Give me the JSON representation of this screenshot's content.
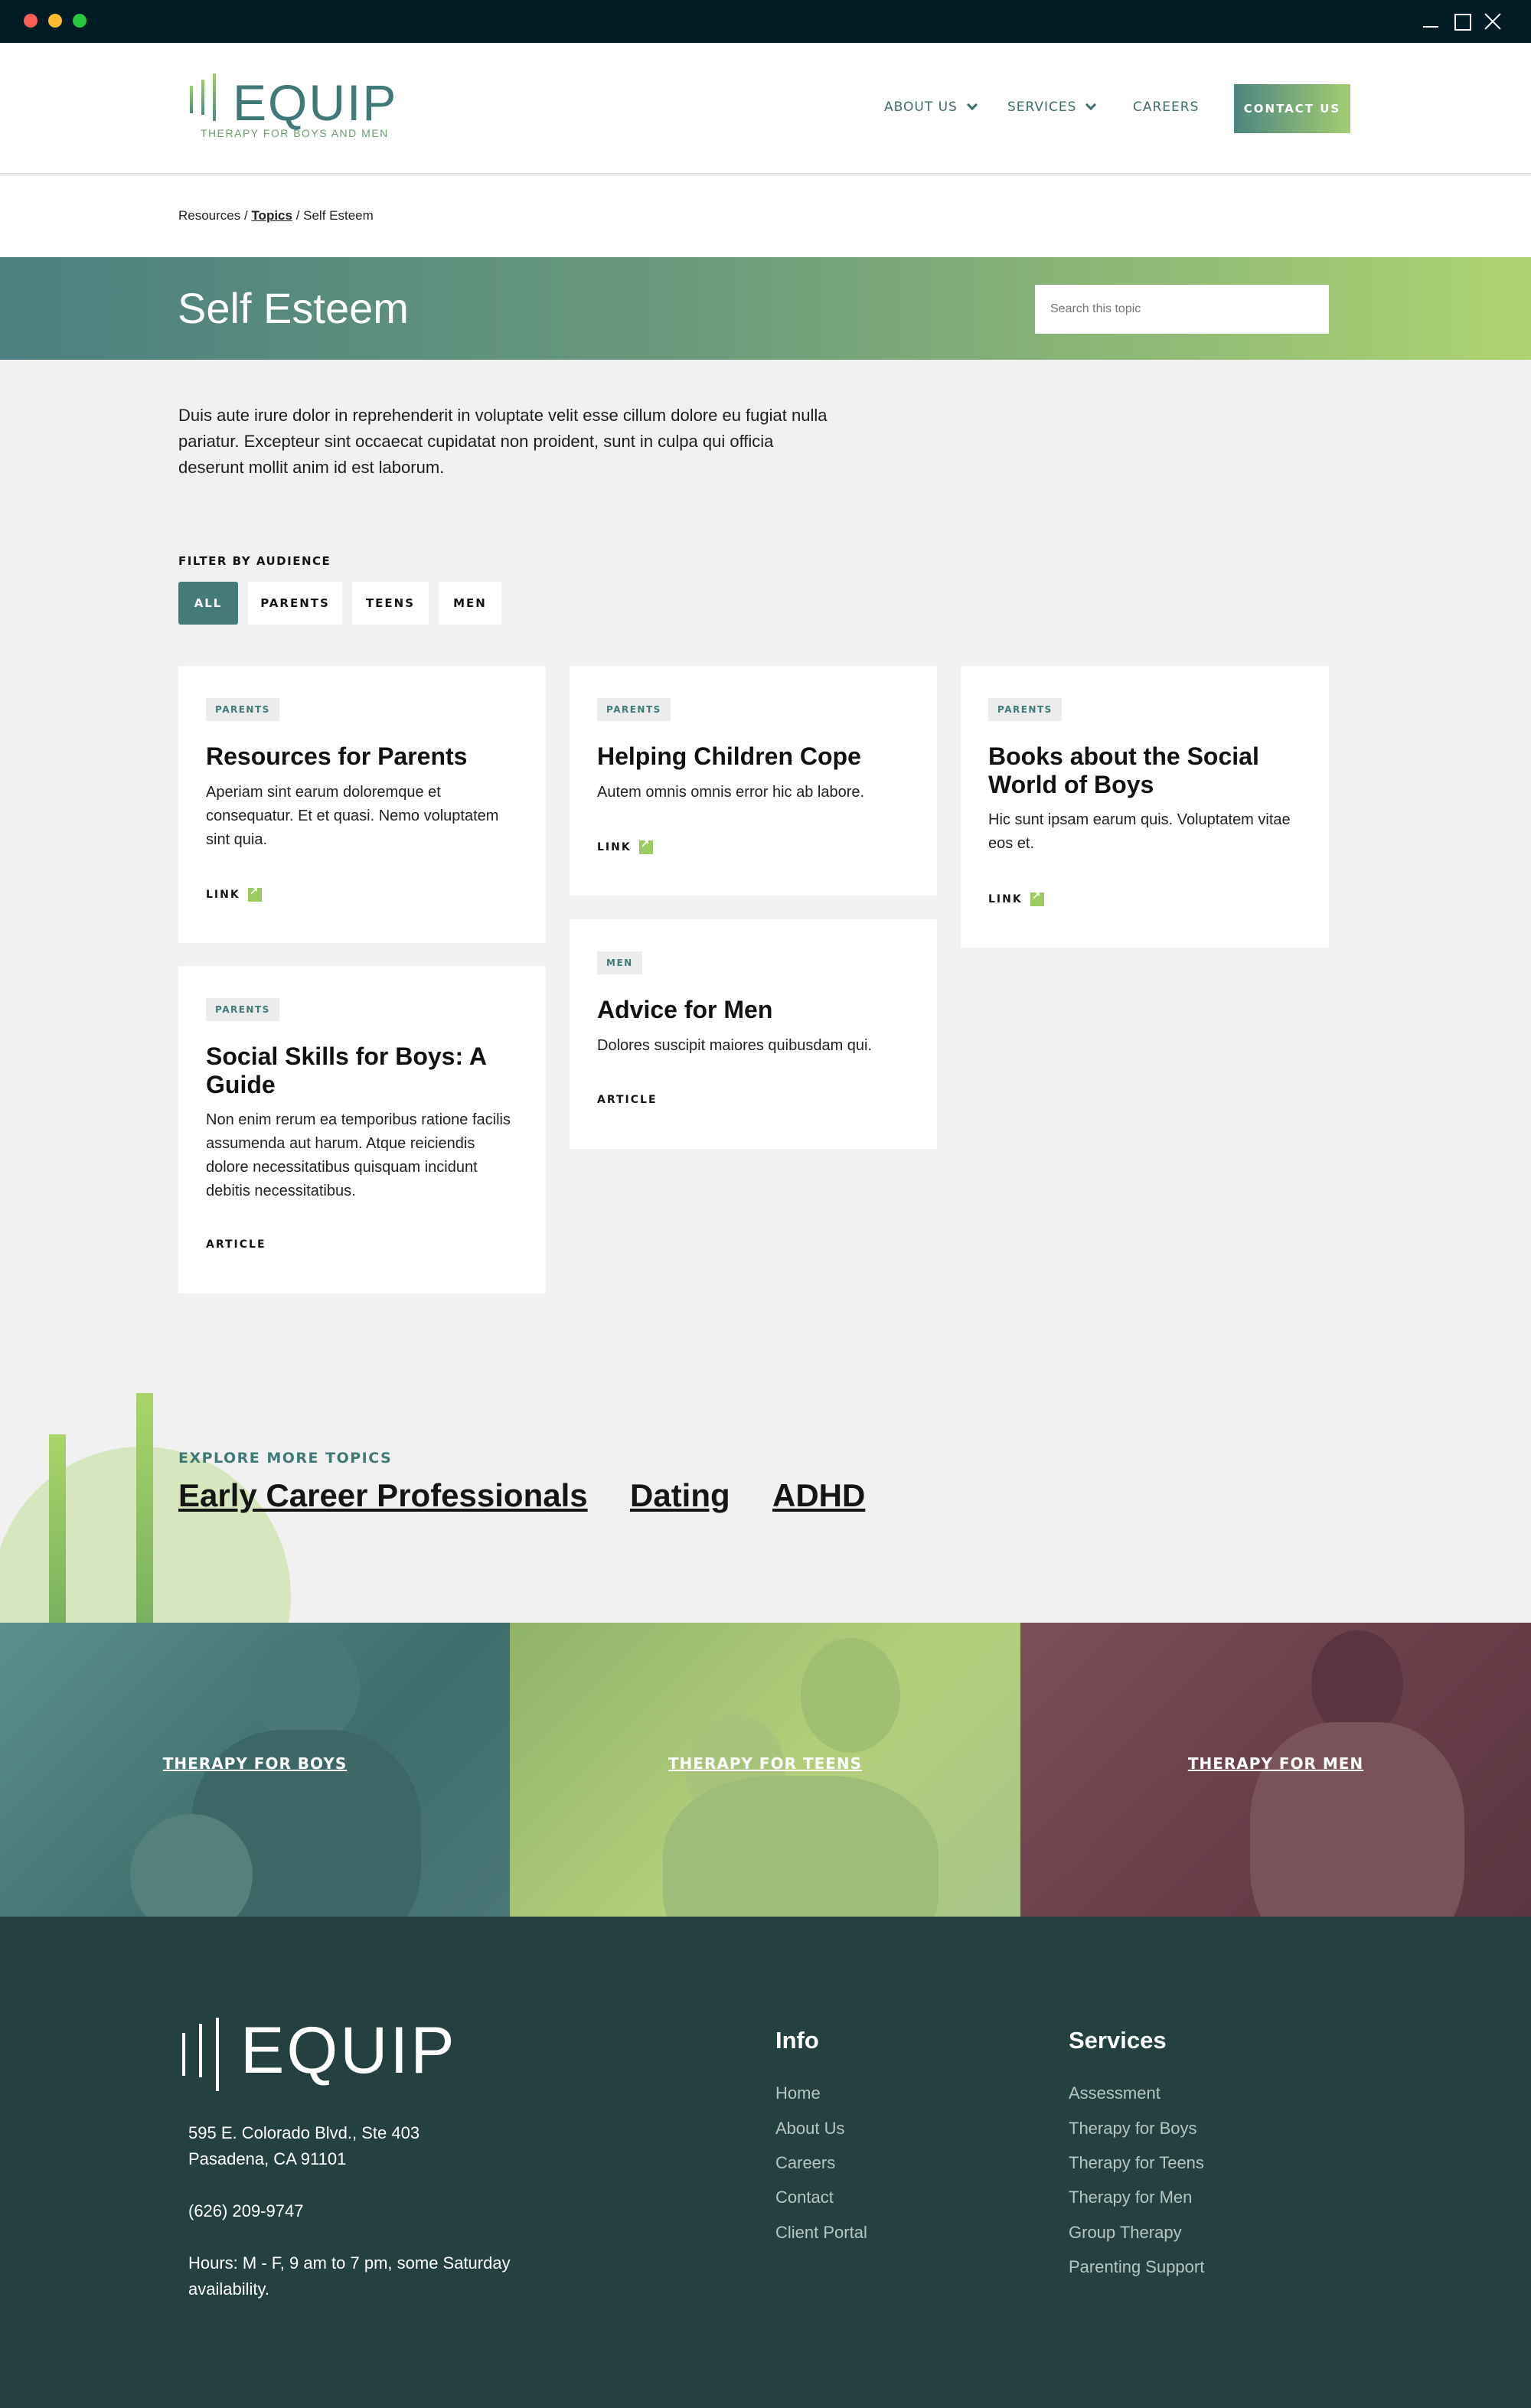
{
  "header": {
    "logo_word": "EQUIP",
    "logo_tagline": "THERAPY FOR BOYS AND MEN",
    "nav": [
      {
        "label": "ABOUT US"
      },
      {
        "label": "SERVICES"
      },
      {
        "label": "CAREERS"
      }
    ],
    "contact_label": "CONTACT US"
  },
  "breadcrumb": {
    "resources": "Resources",
    "sep1": " / ",
    "topics": "Topics",
    "sep2": " / ",
    "current": "Self Esteem"
  },
  "hero": {
    "title": "Self Esteem",
    "search_placeholder": "Search this topic"
  },
  "intro": "Duis aute irure dolor in reprehenderit in voluptate velit esse cillum dolore eu fugiat nulla pariatur. Excepteur sint occaecat cupidatat non proident, sunt in culpa qui officia deserunt mollit anim id est laborum.",
  "filter": {
    "label": "FILTER BY AUDIENCE",
    "options": [
      "ALL",
      "PARENTS",
      "TEENS",
      "MEN"
    ],
    "active": "ALL"
  },
  "cards": [
    {
      "tag": "PARENTS",
      "title": "Resources for Parents",
      "desc": "Aperiam sint earum doloremque et consequatur. Et et quasi. Nemo voluptatem sint quia.",
      "link": "LINK"
    },
    {
      "tag": "PARENTS",
      "title": "Helping Children Cope",
      "desc": "Autem omnis omnis error hic ab labore.",
      "link": "LINK"
    },
    {
      "tag": "PARENTS",
      "title": "Books about the Social World of Boys",
      "desc": "Hic sunt ipsam earum quis. Voluptatem vitae eos et.",
      "link": "LINK"
    },
    {
      "tag": "PARENTS",
      "title": "Social Skills for Boys: A Guide",
      "desc": "Non enim rerum ea temporibus ratione facilis assumenda aut harum. Atque reiciendis dolore necessitatibus quisquam incidunt debitis necessitatibus.",
      "link": "ARTICLE"
    },
    {
      "tag": "MEN",
      "title": "Advice for Men",
      "desc": "Dolores suscipit maiores quibusdam qui.",
      "link": "ARTICLE"
    }
  ],
  "explore": {
    "label": "EXPLORE MORE TOPICS",
    "topics": [
      "Early Career Professionals",
      "Dating",
      "ADHD"
    ]
  },
  "panels": [
    {
      "label": "THERAPY FOR BOYS"
    },
    {
      "label": "THERAPY FOR TEENS"
    },
    {
      "label": "THERAPY FOR MEN"
    }
  ],
  "footer": {
    "logo_word": "EQUIP",
    "address_line1": "595 E. Colorado Blvd., Ste 403",
    "address_line2": "Pasadena, CA 91101",
    "phone": "(626) 209-9747",
    "hours": "Hours: M - F, 9 am to 7 pm, some Saturday availability.",
    "info_heading": "Info",
    "info_links": [
      "Home",
      "About Us",
      "Careers",
      "Contact",
      "Client Portal"
    ],
    "services_heading": "Services",
    "services_links": [
      "Assessment",
      "Therapy for Boys",
      "Therapy for Teens",
      "Therapy for Men",
      "Group Therapy",
      "Parenting Support"
    ]
  },
  "colors": {
    "brand_teal": "#457a7b",
    "brand_green": "#a4cd72",
    "footer_bg": "#254040"
  }
}
